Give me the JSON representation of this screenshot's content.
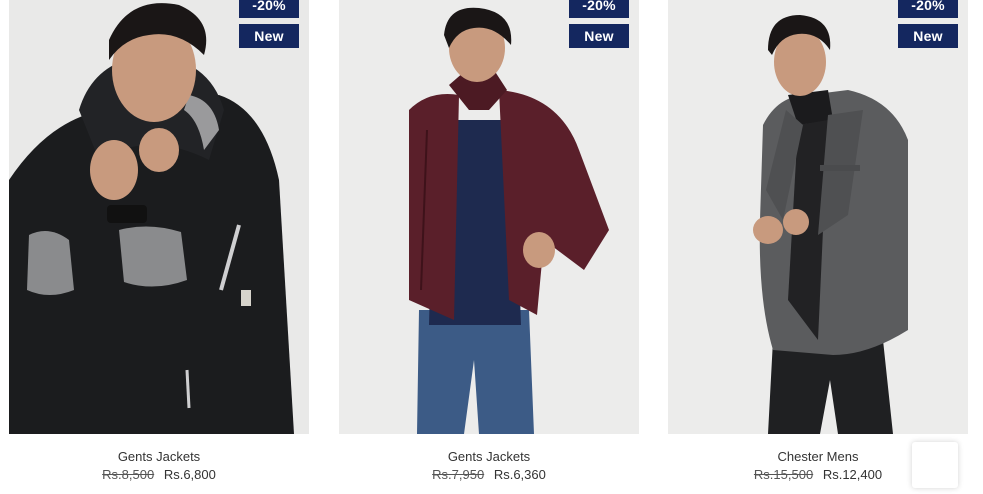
{
  "products": [
    {
      "title": "Gents Jackets",
      "old_price": "Rs.8,500",
      "price": "Rs.6,800",
      "discount_badge": "-20%",
      "new_badge": "New",
      "image_icon": "black-hooded-jacket-photo"
    },
    {
      "title": "Gents Jackets",
      "old_price": "Rs.7,950",
      "price": "Rs.6,360",
      "discount_badge": "-20%",
      "new_badge": "New",
      "image_icon": "maroon-puffer-jacket-photo"
    },
    {
      "title": "Chester Mens",
      "old_price": "Rs.15,500",
      "price": "Rs.12,400",
      "discount_badge": "-20%",
      "new_badge": "New",
      "image_icon": "grey-chester-coat-photo"
    }
  ],
  "colors": {
    "badge_bg": "#14275f",
    "photo_bg": "#ededec",
    "jacket_black": "#1b1c1e",
    "jacket_maroon": "#5a1f2a",
    "coat_grey": "#5b5c5e"
  },
  "floating": {
    "back_to_top_icon": "back-to-top-icon"
  }
}
